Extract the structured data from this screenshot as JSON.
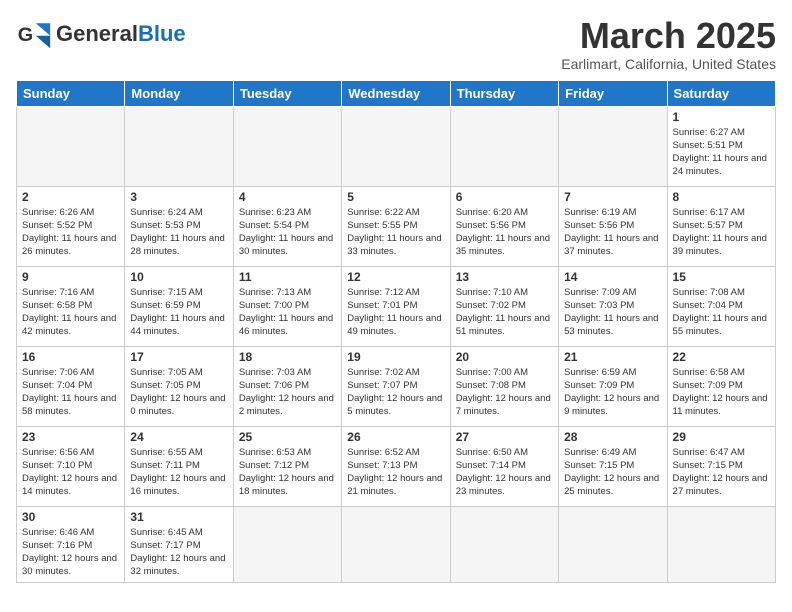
{
  "logo": {
    "text_general": "General",
    "text_blue": "Blue"
  },
  "header": {
    "title": "March 2025",
    "subtitle": "Earlimart, California, United States"
  },
  "columns": [
    "Sunday",
    "Monday",
    "Tuesday",
    "Wednesday",
    "Thursday",
    "Friday",
    "Saturday"
  ],
  "weeks": [
    [
      {
        "day": "",
        "info": ""
      },
      {
        "day": "",
        "info": ""
      },
      {
        "day": "",
        "info": ""
      },
      {
        "day": "",
        "info": ""
      },
      {
        "day": "",
        "info": ""
      },
      {
        "day": "",
        "info": ""
      },
      {
        "day": "1",
        "info": "Sunrise: 6:27 AM\nSunset: 5:51 PM\nDaylight: 11 hours and 24 minutes."
      }
    ],
    [
      {
        "day": "2",
        "info": "Sunrise: 6:26 AM\nSunset: 5:52 PM\nDaylight: 11 hours and 26 minutes."
      },
      {
        "day": "3",
        "info": "Sunrise: 6:24 AM\nSunset: 5:53 PM\nDaylight: 11 hours and 28 minutes."
      },
      {
        "day": "4",
        "info": "Sunrise: 6:23 AM\nSunset: 5:54 PM\nDaylight: 11 hours and 30 minutes."
      },
      {
        "day": "5",
        "info": "Sunrise: 6:22 AM\nSunset: 5:55 PM\nDaylight: 11 hours and 33 minutes."
      },
      {
        "day": "6",
        "info": "Sunrise: 6:20 AM\nSunset: 5:56 PM\nDaylight: 11 hours and 35 minutes."
      },
      {
        "day": "7",
        "info": "Sunrise: 6:19 AM\nSunset: 5:56 PM\nDaylight: 11 hours and 37 minutes."
      },
      {
        "day": "8",
        "info": "Sunrise: 6:17 AM\nSunset: 5:57 PM\nDaylight: 11 hours and 39 minutes."
      }
    ],
    [
      {
        "day": "9",
        "info": "Sunrise: 7:16 AM\nSunset: 6:58 PM\nDaylight: 11 hours and 42 minutes."
      },
      {
        "day": "10",
        "info": "Sunrise: 7:15 AM\nSunset: 6:59 PM\nDaylight: 11 hours and 44 minutes."
      },
      {
        "day": "11",
        "info": "Sunrise: 7:13 AM\nSunset: 7:00 PM\nDaylight: 11 hours and 46 minutes."
      },
      {
        "day": "12",
        "info": "Sunrise: 7:12 AM\nSunset: 7:01 PM\nDaylight: 11 hours and 49 minutes."
      },
      {
        "day": "13",
        "info": "Sunrise: 7:10 AM\nSunset: 7:02 PM\nDaylight: 11 hours and 51 minutes."
      },
      {
        "day": "14",
        "info": "Sunrise: 7:09 AM\nSunset: 7:03 PM\nDaylight: 11 hours and 53 minutes."
      },
      {
        "day": "15",
        "info": "Sunrise: 7:08 AM\nSunset: 7:04 PM\nDaylight: 11 hours and 55 minutes."
      }
    ],
    [
      {
        "day": "16",
        "info": "Sunrise: 7:06 AM\nSunset: 7:04 PM\nDaylight: 11 hours and 58 minutes."
      },
      {
        "day": "17",
        "info": "Sunrise: 7:05 AM\nSunset: 7:05 PM\nDaylight: 12 hours and 0 minutes."
      },
      {
        "day": "18",
        "info": "Sunrise: 7:03 AM\nSunset: 7:06 PM\nDaylight: 12 hours and 2 minutes."
      },
      {
        "day": "19",
        "info": "Sunrise: 7:02 AM\nSunset: 7:07 PM\nDaylight: 12 hours and 5 minutes."
      },
      {
        "day": "20",
        "info": "Sunrise: 7:00 AM\nSunset: 7:08 PM\nDaylight: 12 hours and 7 minutes."
      },
      {
        "day": "21",
        "info": "Sunrise: 6:59 AM\nSunset: 7:09 PM\nDaylight: 12 hours and 9 minutes."
      },
      {
        "day": "22",
        "info": "Sunrise: 6:58 AM\nSunset: 7:09 PM\nDaylight: 12 hours and 11 minutes."
      }
    ],
    [
      {
        "day": "23",
        "info": "Sunrise: 6:56 AM\nSunset: 7:10 PM\nDaylight: 12 hours and 14 minutes."
      },
      {
        "day": "24",
        "info": "Sunrise: 6:55 AM\nSunset: 7:11 PM\nDaylight: 12 hours and 16 minutes."
      },
      {
        "day": "25",
        "info": "Sunrise: 6:53 AM\nSunset: 7:12 PM\nDaylight: 12 hours and 18 minutes."
      },
      {
        "day": "26",
        "info": "Sunrise: 6:52 AM\nSunset: 7:13 PM\nDaylight: 12 hours and 21 minutes."
      },
      {
        "day": "27",
        "info": "Sunrise: 6:50 AM\nSunset: 7:14 PM\nDaylight: 12 hours and 23 minutes."
      },
      {
        "day": "28",
        "info": "Sunrise: 6:49 AM\nSunset: 7:15 PM\nDaylight: 12 hours and 25 minutes."
      },
      {
        "day": "29",
        "info": "Sunrise: 6:47 AM\nSunset: 7:15 PM\nDaylight: 12 hours and 27 minutes."
      }
    ],
    [
      {
        "day": "30",
        "info": "Sunrise: 6:46 AM\nSunset: 7:16 PM\nDaylight: 12 hours and 30 minutes."
      },
      {
        "day": "31",
        "info": "Sunrise: 6:45 AM\nSunset: 7:17 PM\nDaylight: 12 hours and 32 minutes."
      },
      {
        "day": "",
        "info": ""
      },
      {
        "day": "",
        "info": ""
      },
      {
        "day": "",
        "info": ""
      },
      {
        "day": "",
        "info": ""
      },
      {
        "day": "",
        "info": ""
      }
    ]
  ]
}
